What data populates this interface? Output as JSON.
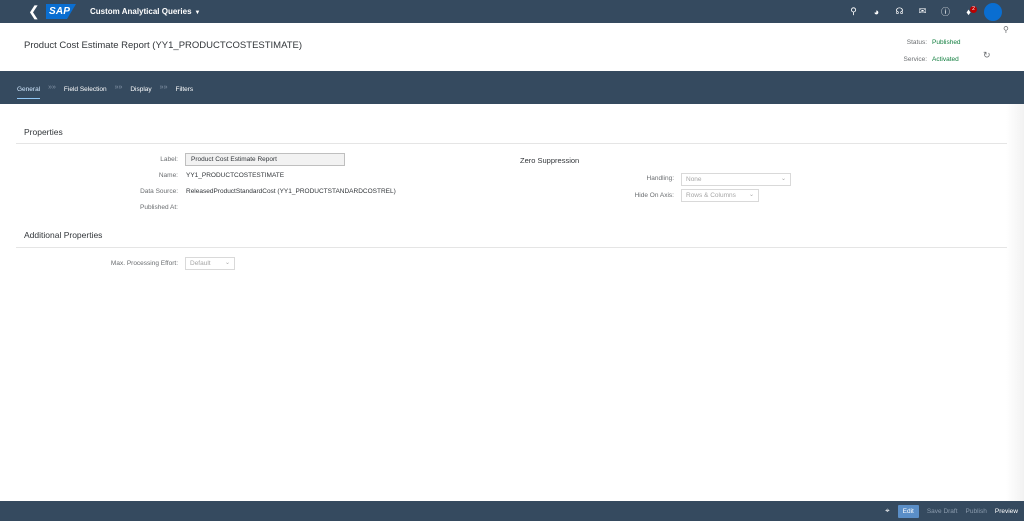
{
  "shell": {
    "app_title": "Custom Analytical Queries",
    "logo_text": "SAP",
    "notification_count": "2",
    "accent": "#354a5f"
  },
  "header": {
    "title": "Product Cost Estimate Report (YY1_PRODUCTCOSTESTIMATE)",
    "status_label": "Status:",
    "status_value": "Published",
    "service_label": "Service:",
    "service_value": "Activated"
  },
  "tabs": [
    {
      "label": "General",
      "active": true
    },
    {
      "label": "Field Selection"
    },
    {
      "label": "Display"
    },
    {
      "label": "Filters"
    }
  ],
  "properties": {
    "title": "Properties",
    "label_label": "Label:",
    "label_value": "Product Cost Estimate Report",
    "name_label": "Name:",
    "name_value": "YY1_PRODUCTCOSTESTIMATE",
    "datasource_label": "Data Source:",
    "datasource_value": "ReleasedProductStandardCost (YY1_PRODUCTSTANDARDCOSTREL)",
    "published_label": "Published At:",
    "published_value": ""
  },
  "zero_suppression": {
    "title": "Zero Suppression",
    "handling_label": "Handling:",
    "handling_value": "None",
    "hide_axis_label": "Hide On Axis:",
    "hide_axis_value": "Rows & Columns"
  },
  "additional": {
    "title": "Additional Properties",
    "effort_label": "Max. Processing Effort:",
    "effort_value": "Default"
  },
  "footer": {
    "edit": "Edit",
    "save_draft": "Save Draft",
    "publish": "Publish",
    "preview": "Preview"
  }
}
